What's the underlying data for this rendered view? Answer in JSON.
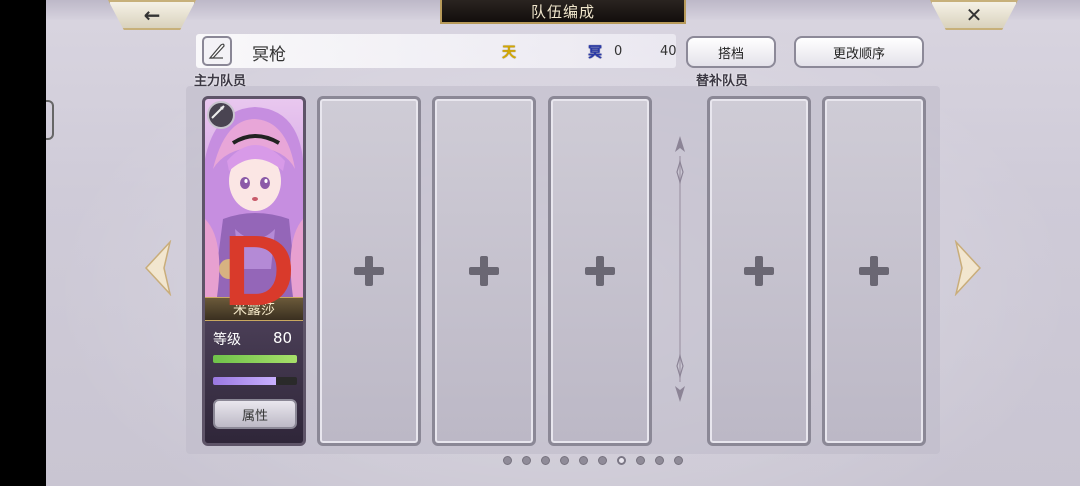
{
  "header": {
    "title": "队伍编成",
    "back_icon": "back-arrow-icon",
    "close_icon": "close-x-icon",
    "back_glyph": "←",
    "close_glyph": "✕"
  },
  "team": {
    "name": "冥枪",
    "stat_a_label": "天",
    "stat_a_value": "0",
    "stat_b_label": "冥",
    "stat_b_value": "40",
    "colors": {
      "stat_a": "#d4a800",
      "stat_b": "#2a3aa8"
    }
  },
  "actions": {
    "partner_label": "搭档",
    "reorder_label": "更改顺序"
  },
  "sections": {
    "main_label": "主力队员",
    "sub_label": "替补队员"
  },
  "character": {
    "name": "米露莎",
    "level_label": "等级",
    "level_value": "80",
    "hp_fraction": 1.0,
    "sp_fraction": 0.75,
    "attr_button_label": "属性",
    "weapon_icon": "spear-icon",
    "marker": "D"
  },
  "empty_slots": {
    "main_count": 3,
    "sub_count": 2,
    "icon": "plus-icon"
  },
  "pagination": {
    "total": 10,
    "active_index": 6
  },
  "colors": {
    "accent_gold": "#c9a860",
    "title_bg": "#1a1410",
    "marker_red": "#d93a2b"
  }
}
